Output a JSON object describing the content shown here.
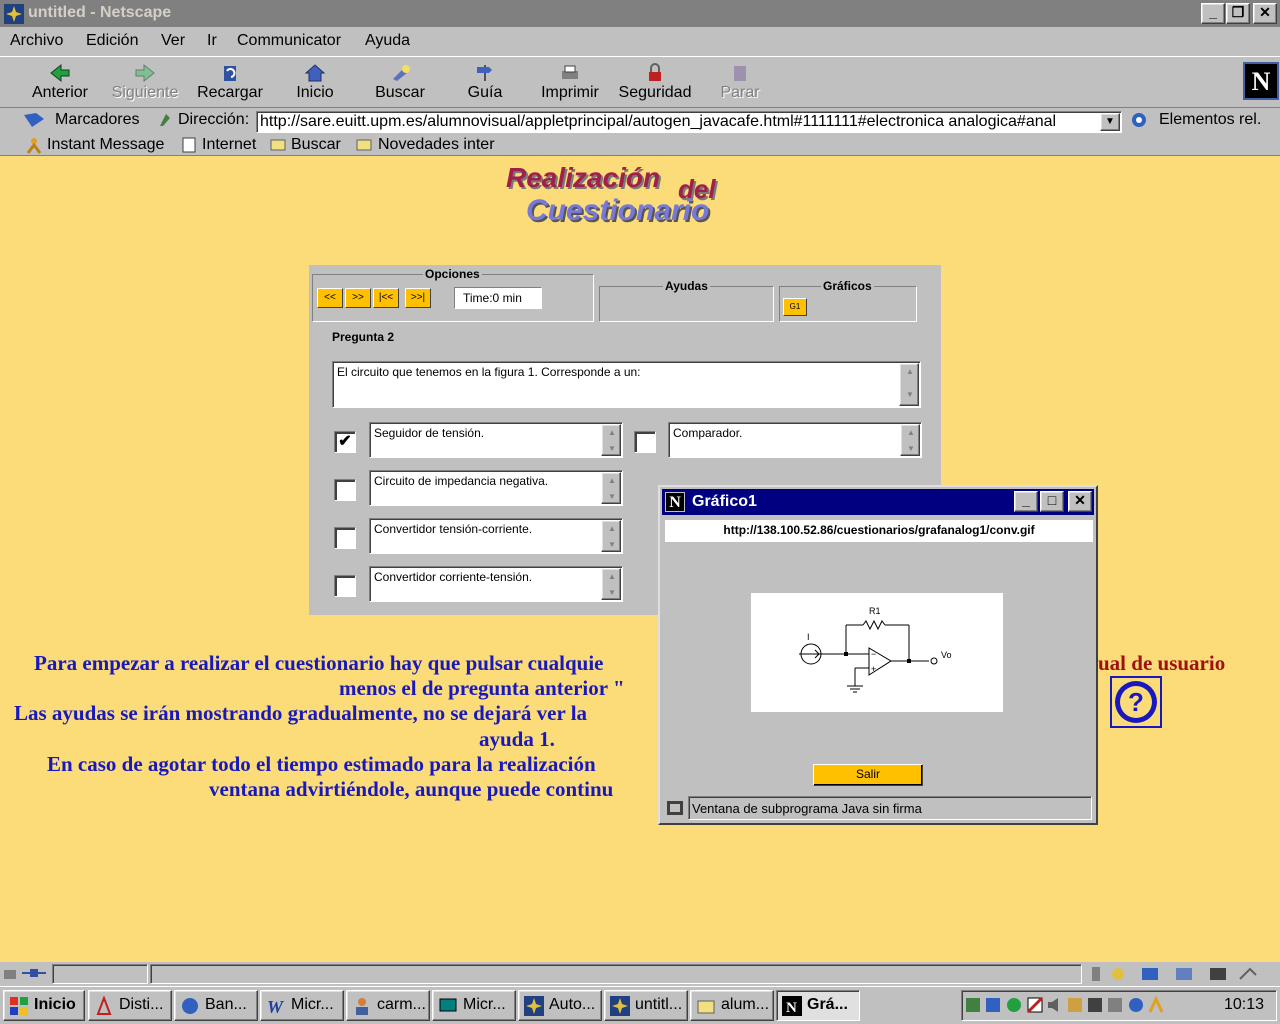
{
  "window": {
    "title": "untitled - Netscape"
  },
  "menu": [
    "Archivo",
    "Edición",
    "Ver",
    "Ir",
    "Communicator",
    "Ayuda"
  ],
  "toolbar": {
    "back": "Anterior",
    "forward": "Siguiente",
    "reload": "Recargar",
    "home": "Inicio",
    "search": "Buscar",
    "guide": "Guía",
    "print": "Imprimir",
    "security": "Seguridad",
    "stop": "Parar"
  },
  "location": {
    "bookmarks": "Marcadores",
    "label": "Dirección:",
    "url": "http://sare.euitt.upm.es/alumnovisual/appletprincipal/autogen_javacafe.html#1111111#electronica analogica#anal",
    "related": "Elementos rel."
  },
  "personal": [
    "Instant Message",
    "Internet",
    "Buscar",
    "Novedades inter"
  ],
  "page": {
    "header": {
      "line1": "Realización",
      "line2": "del",
      "line3": "Cuestionario"
    },
    "applet": {
      "opciones_label": "Opciones",
      "nav_buttons": [
        "<<",
        ">>",
        "|<<",
        ">>|"
      ],
      "time": "Time:0 min",
      "ayudas_label": "Ayudas",
      "graficos_label": "Gráficos",
      "g1": "G1",
      "question_label": "Pregunta 2",
      "question_text": "El circuito que tenemos en la figura 1. Corresponde a un:",
      "options": [
        {
          "text": "Seguidor de tensión.",
          "checked": "✔"
        },
        {
          "text": "Comparador.",
          "checked": ""
        },
        {
          "text": "Circuito de impedancia negativa.",
          "checked": ""
        },
        {
          "text": "Convertidor tensión-corriente.",
          "checked": ""
        },
        {
          "text": "Convertidor corriente-tensión.",
          "checked": ""
        }
      ]
    },
    "instructions": {
      "l1": "Para empezar a realizar el cuestionario hay que pulsar cualquie",
      "l1b": "ual de usuario",
      "l2": "menos el de pregunta anterior \"",
      "l3": "Las ayudas se irán mostrando gradualmente, no se dejará ver la",
      "l4": "ayuda 1.",
      "l5": "En caso de agotar todo el tiempo estimado para la realización",
      "l6": "ventana advirtiéndole, aunque puede continu"
    }
  },
  "popup": {
    "title": "Gráfico1",
    "url": "http://138.100.52.86/cuestionarios/grafanalog1/conv.gif",
    "circuit": {
      "r_label": "R1",
      "i_label": "I",
      "out_label": "Vo",
      "minus": "−",
      "plus": "+"
    },
    "salir": "Salir",
    "status": "Ventana de subprograma Java sin firma"
  },
  "taskbar": {
    "start": "Inicio",
    "tasks": [
      "Disti...",
      "Ban...",
      "Micr...",
      "carm...",
      "Micr...",
      "Auto...",
      "untitl...",
      "alum...",
      "Grá..."
    ],
    "clock": "10:13"
  },
  "colors": {
    "page_bg": "#fcdc78",
    "title_active": "#000080",
    "link_blue": "#1818c0",
    "accent_yellow": "#ffc000",
    "header_red": "#a0204a"
  }
}
